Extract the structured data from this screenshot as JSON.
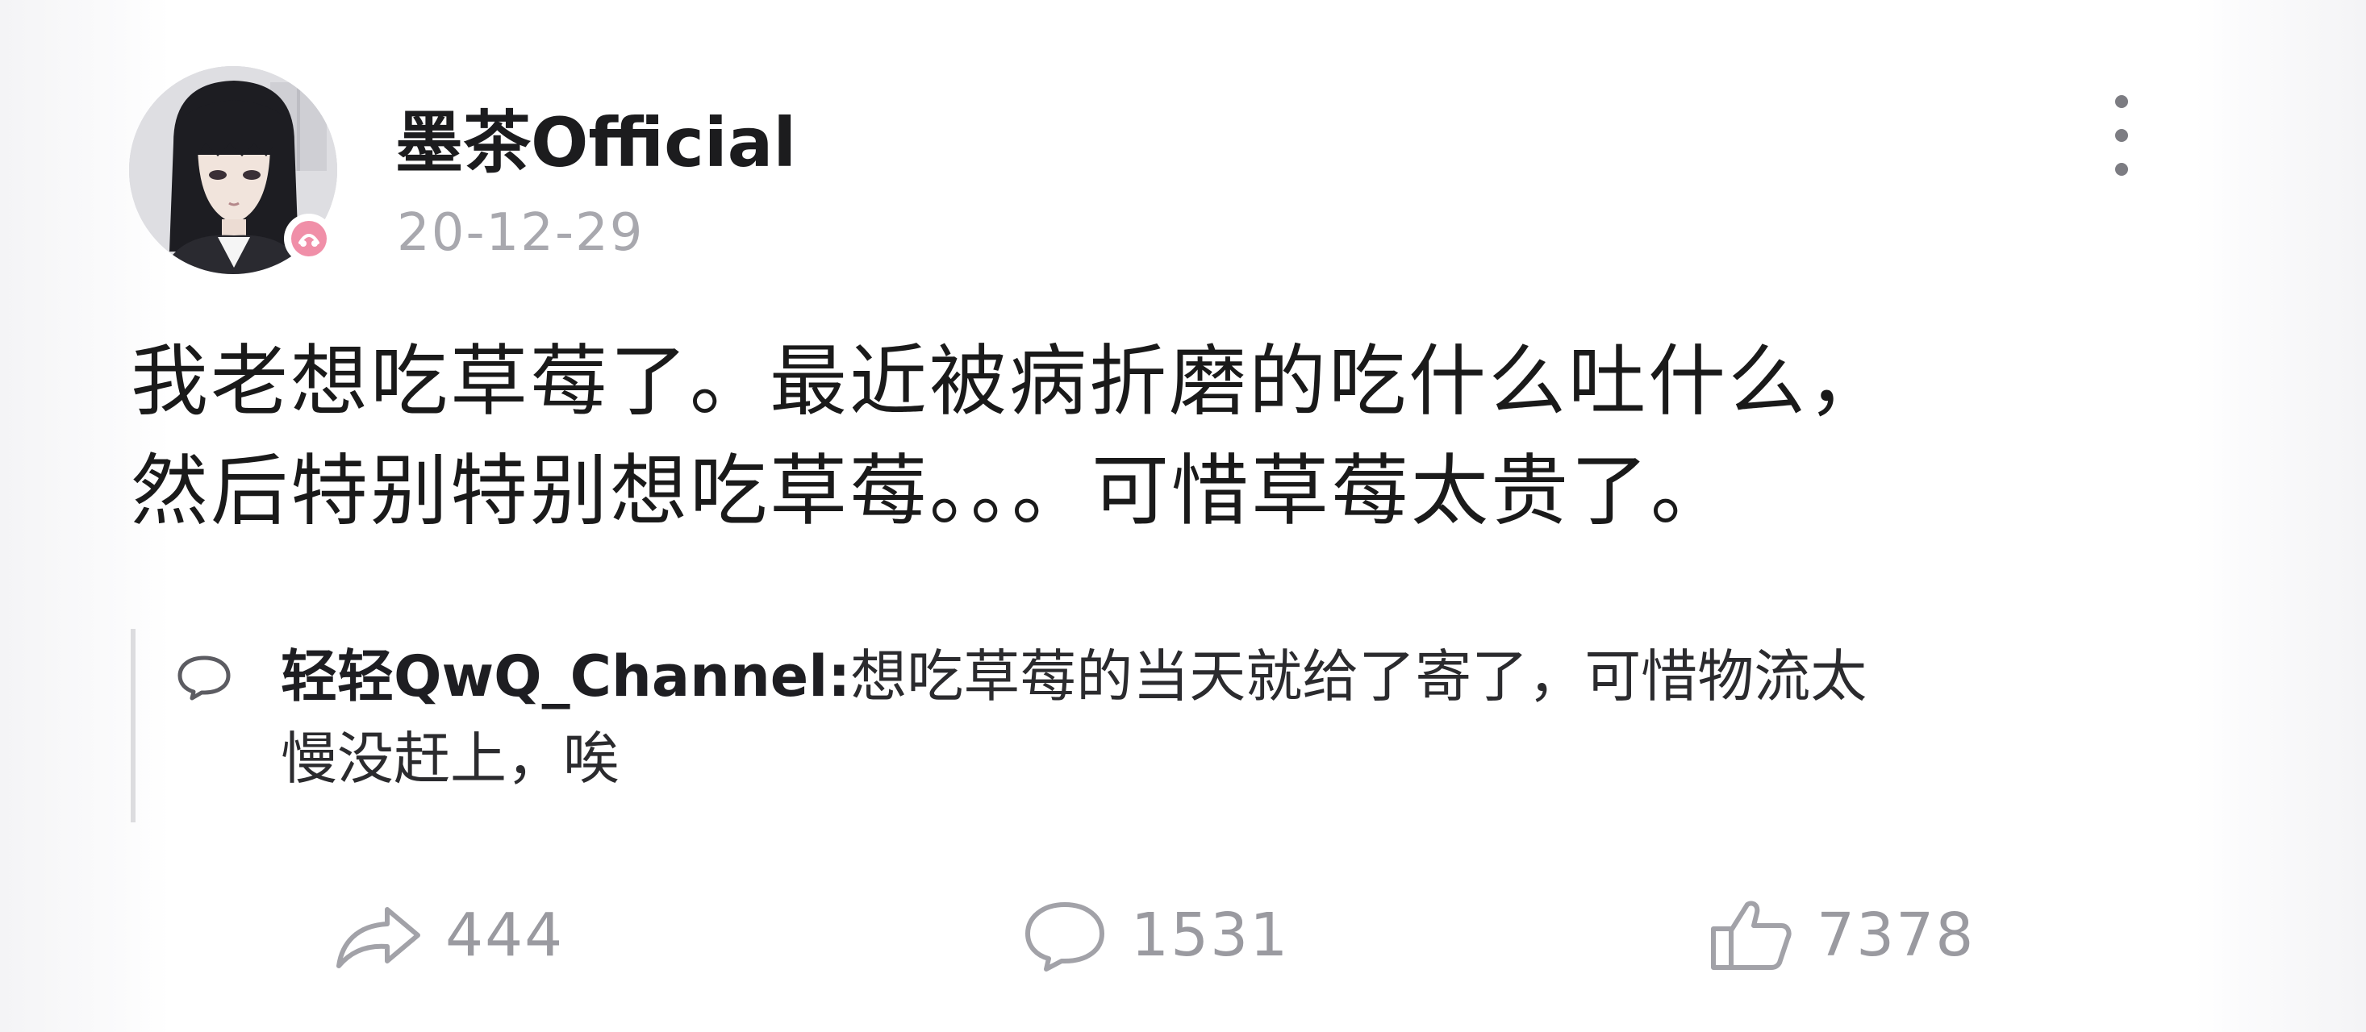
{
  "post": {
    "username": "墨茶Official",
    "date": "20-12-29",
    "body_lines": [
      "我老想吃草莓了。最近被病折磨的吃什么吐什么，",
      "然后特别特别想吃草莓。。。可惜草莓太贵了。"
    ]
  },
  "quote": {
    "author": "轻轻QwQ_Channel:",
    "text_line1": "想吃草莓的当天就给了寄了，可惜物流太",
    "text_line2": "慢没赶上，唉"
  },
  "actions": {
    "repost_count": "444",
    "comment_count": "1531",
    "like_count": "7378"
  },
  "icons": {
    "more": "more-vertical-icon",
    "repost": "share-arrow-icon",
    "comment": "comment-bubble-icon",
    "like": "thumbs-up-icon",
    "badge": "verified-badge-icon"
  }
}
